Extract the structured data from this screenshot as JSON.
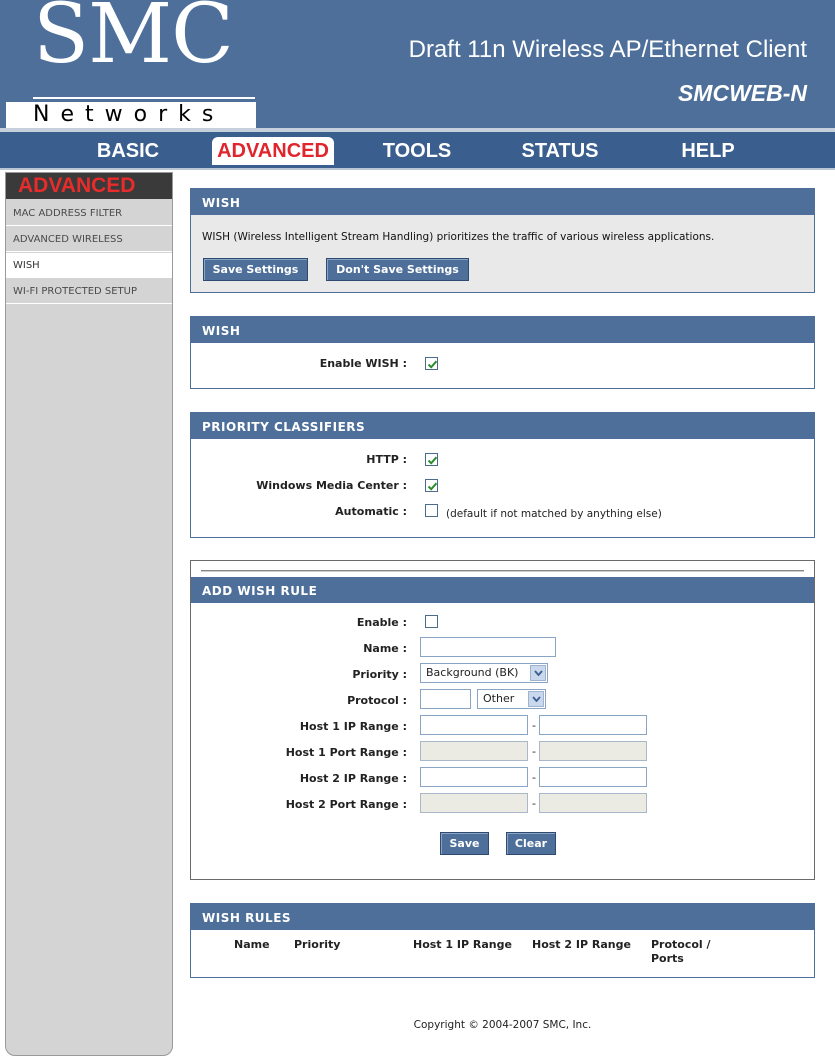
{
  "header": {
    "logo_main": "SMC",
    "logo_sub": "Networks",
    "product_title": "Draft 11n Wireless AP/Ethernet Client",
    "model": "SMCWEB-N"
  },
  "nav": {
    "basic": "BASIC",
    "advanced": "ADVANCED",
    "tools": "TOOLS",
    "status": "STATUS",
    "help": "HELP"
  },
  "sidebar": {
    "title": "ADVANCED",
    "items": [
      "MAC ADDRESS FILTER",
      "ADVANCED WIRELESS",
      "WISH",
      "WI-FI PROTECTED SETUP"
    ]
  },
  "intro_panel": {
    "title": "WISH",
    "text": "WISH (Wireless Intelligent Stream Handling) prioritizes the traffic of various wireless applications.",
    "save_label": "Save Settings",
    "dont_save_label": "Don't Save Settings"
  },
  "wish_panel": {
    "title": "WISH",
    "enable_label": "Enable WISH :",
    "enable_checked": true
  },
  "classifiers_panel": {
    "title": "PRIORITY CLASSIFIERS",
    "http_label": "HTTP :",
    "http_checked": true,
    "wmc_label": "Windows Media Center :",
    "wmc_checked": true,
    "auto_label": "Automatic :",
    "auto_checked": false,
    "auto_note": "(default if not matched by anything else)"
  },
  "add_rule_panel": {
    "title": "ADD WISH RULE",
    "enable_label": "Enable :",
    "name_label": "Name :",
    "name_value": "",
    "priority_label": "Priority :",
    "priority_value": "Background (BK)",
    "protocol_label": "Protocol :",
    "protocol_number": "",
    "protocol_value": "Other",
    "host1_ip_label": "Host 1 IP Range :",
    "host1_port_label": "Host 1 Port Range :",
    "host2_ip_label": "Host 2 IP Range :",
    "host2_port_label": "Host 2 Port Range :",
    "dash": "-",
    "save_label": "Save",
    "clear_label": "Clear"
  },
  "rules_panel": {
    "title": "WISH RULES",
    "columns": [
      "Name",
      "Priority",
      "Host 1 IP Range",
      "Host 2 IP Range",
      "Protocol /",
      "Ports"
    ]
  },
  "footer": {
    "copyright": "Copyright © 2004-2007 SMC, Inc."
  },
  "colors": {
    "header_blue": "#4d6f9a",
    "nav_blue": "#3a5f8f",
    "active_red": "#e0262d",
    "check_green": "#2e8b2e"
  }
}
